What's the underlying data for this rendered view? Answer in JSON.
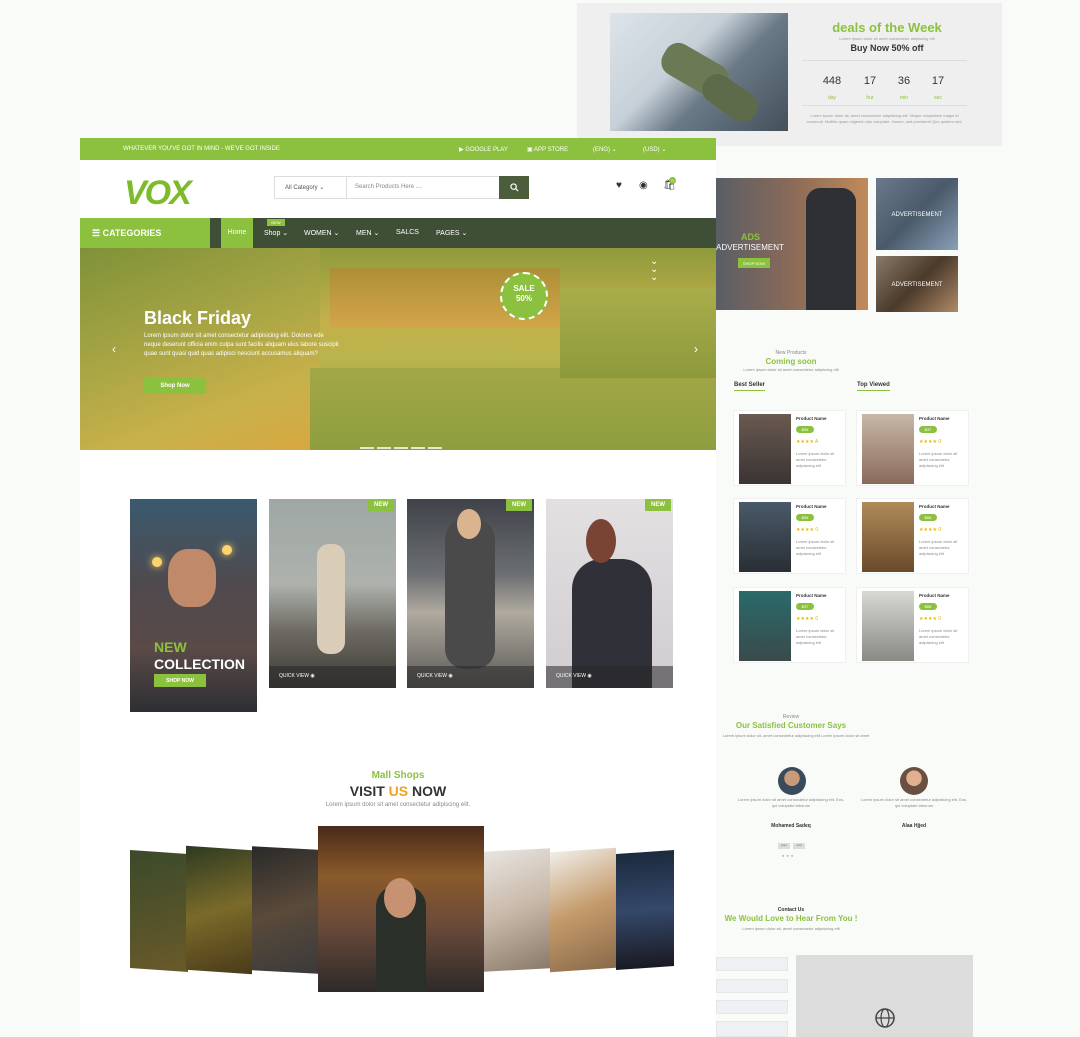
{
  "deals": {
    "title": "deals of the Week",
    "sub": "Lorem ipsum dolor sit amet consectetur adipiscing elit",
    "offer": "Buy Now 50% off",
    "countdown": [
      {
        "value": "448",
        "unit": "day"
      },
      {
        "value": "17",
        "unit": "hur"
      },
      {
        "value": "36",
        "unit": "min"
      },
      {
        "value": "17",
        "unit": "sec"
      }
    ],
    "desc": "Lorem ipsum dolor sit, amet consectetur adipisicing elit. Neque voluptatem magni et commodi. Mollitia quam eligendi odio voluptate. Harum, sed provident! Quo quidem sed."
  },
  "topbar": {
    "tagline": "WHATEVER YOU'VE GOT IN MIND - WE'VE GOT INSIDE",
    "google_play": "GOOGLE PLAY",
    "app_store": "APP STORE",
    "lang": "(ENG)",
    "currency": "(USD)"
  },
  "header": {
    "logo": "VOX",
    "category": "All Category",
    "search_placeholder": "Search Products Here ....",
    "cart_count": "0"
  },
  "nav": {
    "categories": "CATEGORIES",
    "home": "Home",
    "shop": "Shop",
    "new_badge": "NEW",
    "women": "WOMEN",
    "men": "MEN",
    "sales": "SALCS",
    "pages": "PAGES"
  },
  "hero": {
    "title": "Black Friday",
    "text": "Lorem ipsum dolor sit amet consectetur adipisicing elit. Dolores ede neque deserunt officia enim culpa sunt facilis aliquam eius labore suscipit quae sunt quasi quid quas adipisci nesciunt accusamus aliquam?",
    "button": "Shop Now",
    "sale_line1": "SALE",
    "sale_line2": "50%"
  },
  "collection": {
    "line1": "NEW",
    "line2": "COLLECTION",
    "button": "SHOP NOW",
    "new_badge": "NEW",
    "quick_view": "QUICK VIEW"
  },
  "mall": {
    "kicker": "Mall Shops",
    "title_a": "VISIT ",
    "title_b": "US",
    "title_c": " NOW",
    "sub": "Lorem ipsum dolor sit amet consectetur adipiscing elit."
  },
  "ads": {
    "big_line1": "ADS",
    "big_line2": "ADVERTISEMENT",
    "big_button": "SHOP NOW",
    "small1": "ADVERTISEMENT",
    "small2": "ADVERTISEMENT"
  },
  "products": {
    "kicker": "New Products",
    "title": "Coming soon",
    "sub": "Lorem ipsum dolor sit amet consectetur adipiscing elit",
    "best_seller": "Best Seller",
    "top_viewed": "Top Viewed",
    "items": [
      {
        "name": "Product Name",
        "price": "$55",
        "rating": "★★★★ A",
        "desc": "Lorem ipsum dolor sit amet consectetur adipisicing elit"
      },
      {
        "name": "Product Name",
        "price": "$37",
        "rating": "★★★★ 0",
        "desc": "Lorem ipsum dolor sit amet consectetur adipisicing elit"
      },
      {
        "name": "Product Name",
        "price": "$55",
        "rating": "★★★★ 0",
        "desc": "Lorem ipsum dolor sit amet consectetur adipisicing elit"
      },
      {
        "name": "Product Name",
        "price": "$66",
        "rating": "★★★★ 0",
        "desc": "Lorem ipsum dolor sit amet consectetur adipisicing elit"
      },
      {
        "name": "Product Name",
        "price": "$37",
        "rating": "★★★★ 0",
        "desc": "Lorem ipsum dolor sit amet consectetur adipisicing elit"
      },
      {
        "name": "Product Name",
        "price": "$66",
        "rating": "★★★★ 0",
        "desc": "Lorem ipsum dolor sit amet consectetur adipisicing elit"
      }
    ]
  },
  "reviews": {
    "kicker": "Review",
    "title": "Our Satisfied Customer Says",
    "sub": "Lorem ipsum dolor sit, amet consectetur adipisicing elit Lorem ipsum dolor sit amet",
    "items": [
      {
        "text": "Lorem ipsum dolor sit amet consectetur adipisicing elit. Eos, qui voluptate laborum",
        "name": "Mohamed Sadeq"
      },
      {
        "text": "Lorem ipsum dolor sit amet consectetur adipisicing elit. Eos, qui voluptate laborum",
        "name": "Alaa Hjjed"
      }
    ],
    "prev": "prev",
    "next": "next"
  },
  "contact": {
    "kicker": "Contact Us",
    "title": "We Would Love to Hear From You !",
    "sub": "Lorem ipsum dolor sit, amet consectetur adipisicing elit"
  },
  "colors": {
    "accent": "#8cc13f",
    "nav_dark": "#3f4f35"
  }
}
